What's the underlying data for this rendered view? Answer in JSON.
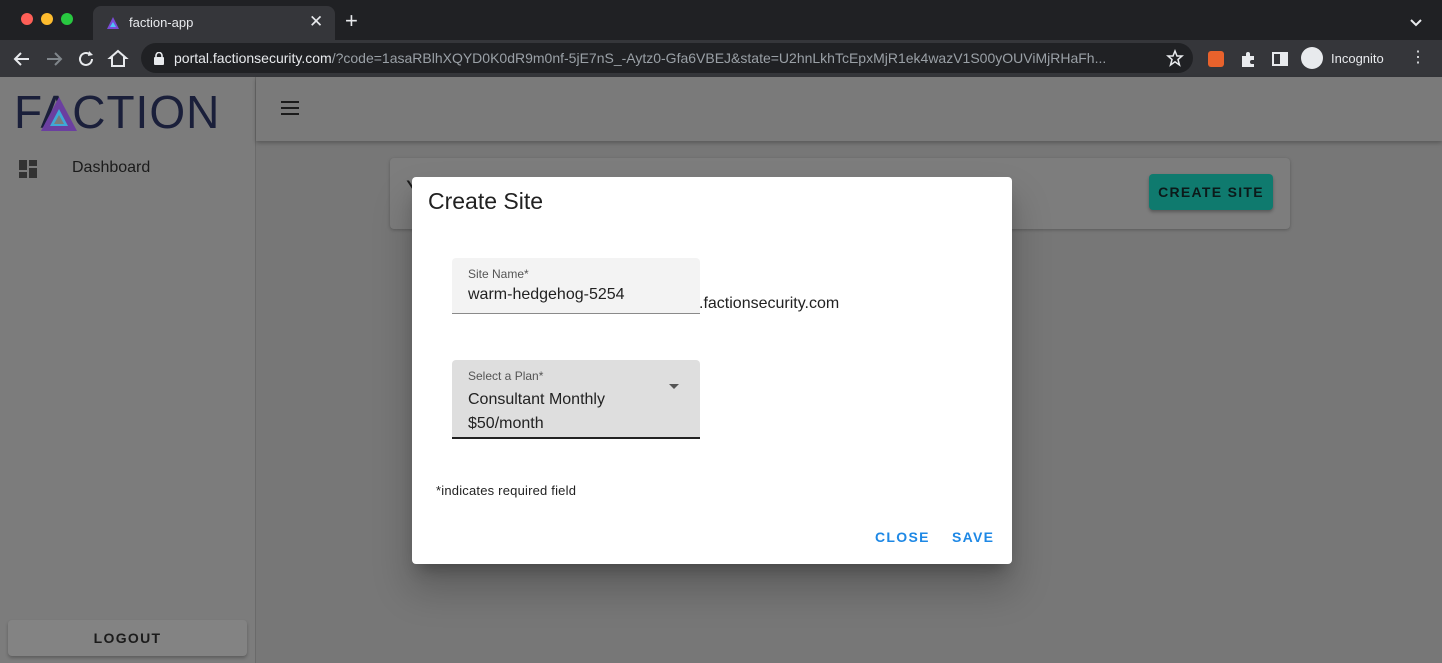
{
  "browser": {
    "tab_title": "faction-app",
    "tab_close": "✕",
    "new_tab": "+",
    "url_host": "portal.factionsecurity.com",
    "url_rest": "/?code=1asaRBlhXQYD0K0dR9m0nf-5jE7nS_-Aytz0-Gfa6VBEJ&state=U2hnLkhTcEpxMjR1ek4wazV1S00yOUViMjRHaFh...",
    "incognito_label": "Incognito"
  },
  "sidebar": {
    "logo_text": "FACTION",
    "dashboard_label": "Dashboard",
    "logout_label": "LOGOUT"
  },
  "main": {
    "card_title_partial": "Y",
    "create_site_label": "CREATE SITE"
  },
  "dialog": {
    "title": "Create Site",
    "site_name_label": "Site Name*",
    "site_name_value": "warm-hedgehog-5254",
    "domain_suffix": ".factionsecurity.com",
    "plan_label": "Select a Plan*",
    "plan_value": "Consultant Monthly $50/month",
    "required_note": "*indicates required field",
    "close_label": "CLOSE",
    "save_label": "SAVE"
  },
  "colors": {
    "accent_teal": "#0f7a6e",
    "dialog_button": "#1e88e5",
    "logo_navy": "#1a1f3a"
  }
}
